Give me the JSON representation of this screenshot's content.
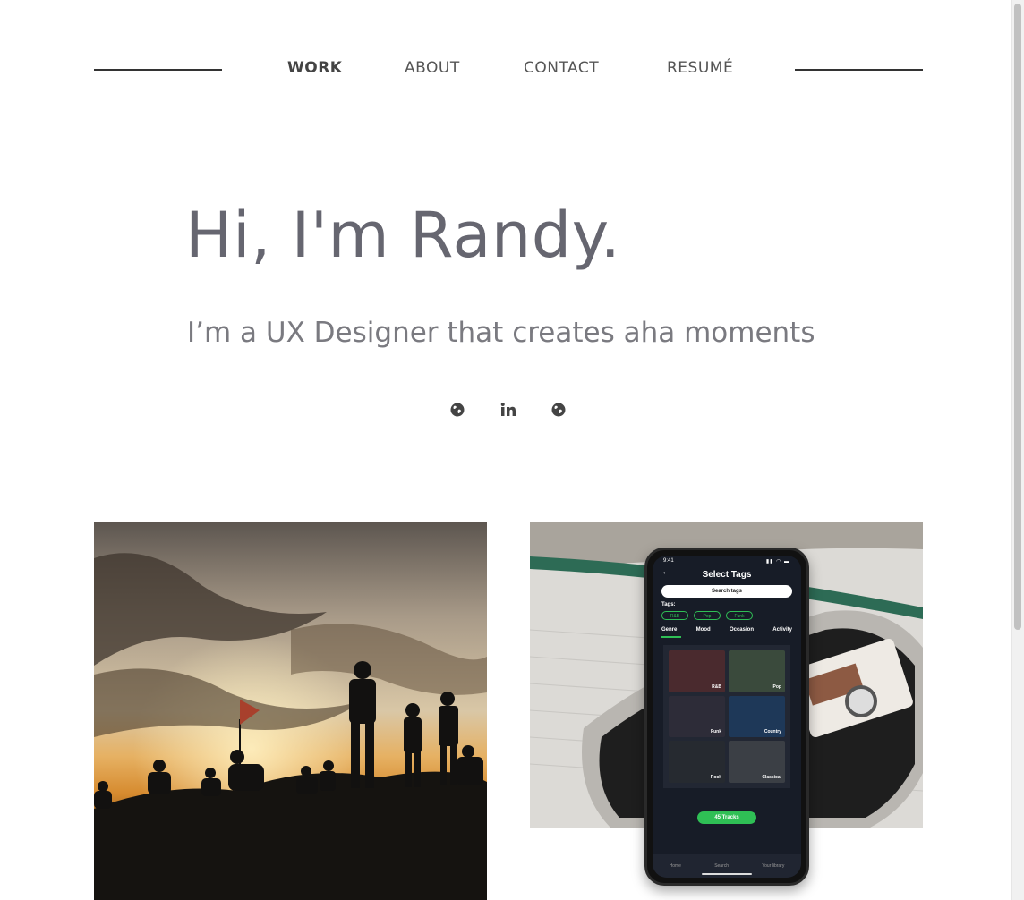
{
  "nav": {
    "items": [
      {
        "label": "WORK",
        "active": true
      },
      {
        "label": "ABOUT",
        "active": false
      },
      {
        "label": "CONTACT",
        "active": false
      },
      {
        "label": "RESUMÉ",
        "active": false
      }
    ]
  },
  "hero": {
    "title": "Hi, I'm Randy.",
    "subtitle": "I’m a UX Designer that creates aha moments"
  },
  "social": {
    "icons": [
      "globe-icon",
      "linkedin-icon",
      "globe-icon"
    ]
  },
  "projects": {
    "phone": {
      "status_time": "9:41",
      "screen_title": "Select Tags",
      "search_placeholder": "Search tags",
      "tags_label": "Tags:",
      "tags": [
        "R&B",
        "Pop",
        "Funk"
      ],
      "tabs": [
        "Genre",
        "Mood",
        "Occasion",
        "Activity"
      ],
      "tiles": [
        "R&B",
        "Pop",
        "Funk",
        "Country",
        "Rock",
        "Classical"
      ],
      "tracks_button": "45 Tracks",
      "bottom_nav": [
        "Home",
        "Search",
        "Your library"
      ]
    }
  },
  "colors": {
    "accent_green": "#2fbf55",
    "text_gray": "#666670"
  }
}
